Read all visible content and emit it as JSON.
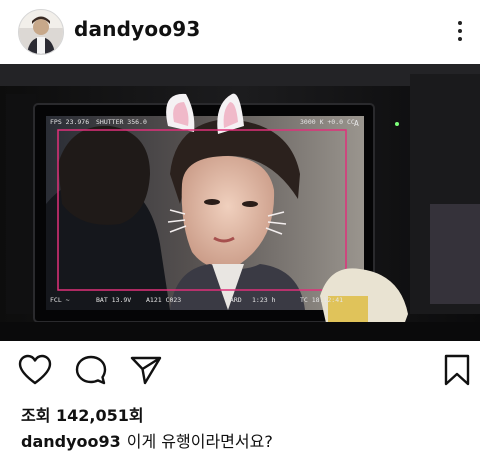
{
  "post": {
    "username": "dandyoo93",
    "views_label": "조회",
    "views_count": "142,051회",
    "caption_user": "dandyoo93",
    "caption_text": "이게 유행이라면서요?"
  },
  "monitor": {
    "fps": "FPS 23.976",
    "shutter": "SHUTTER 356.0",
    "wb": "3000 K  +0.0 CC",
    "iso_mark": "A",
    "lens": "FCL ~",
    "battery": "BAT 13.9V",
    "clip": "A121 C023",
    "card": "CARD",
    "remain": "1:23 h",
    "timecode": "TC 18:12:41"
  },
  "icons": {
    "like": "heart-icon",
    "comment": "comment-icon",
    "share": "send-icon",
    "save": "bookmark-icon",
    "more": "more-vertical-icon"
  },
  "colors": {
    "frame_line": "#e0307a",
    "text": "#111111"
  }
}
